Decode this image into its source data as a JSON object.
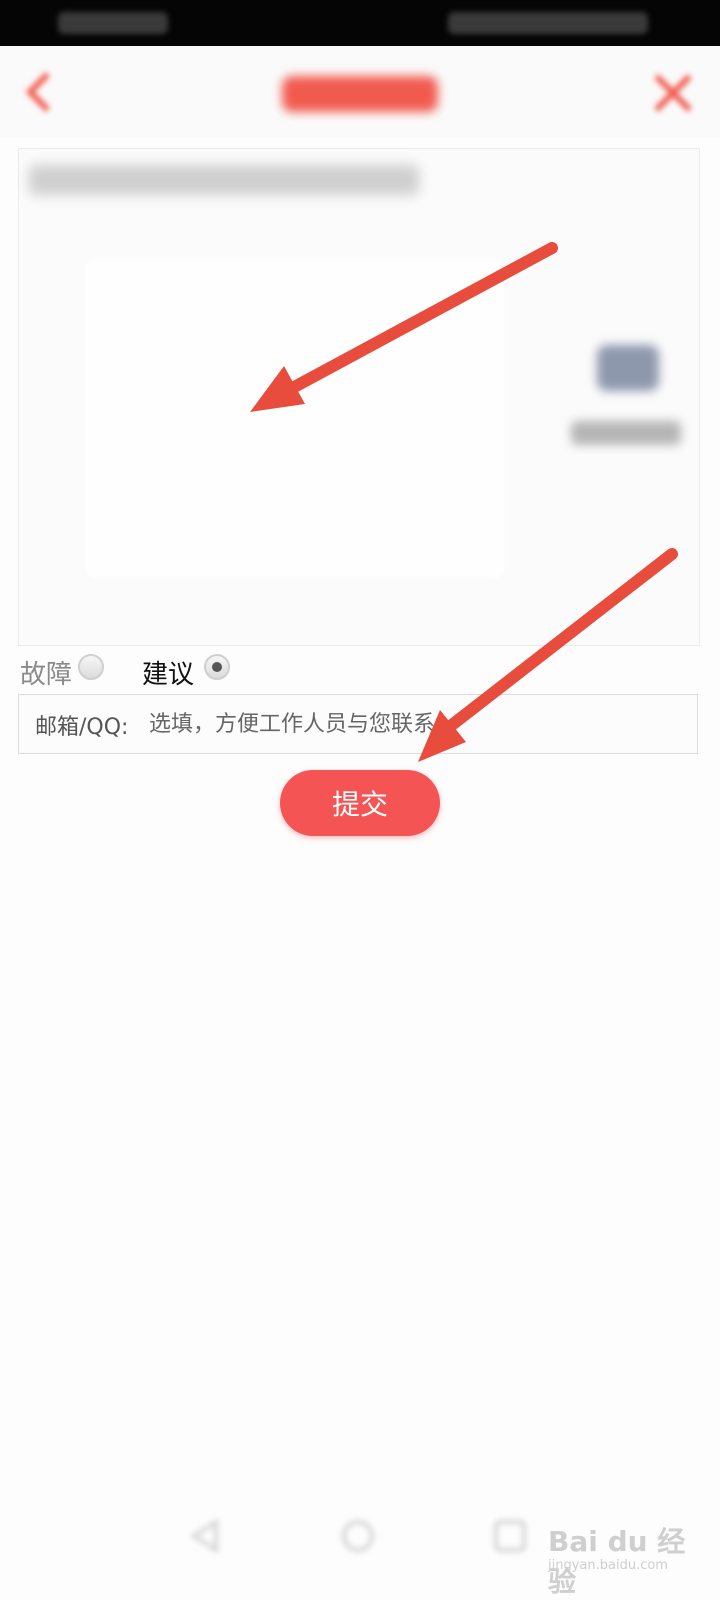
{
  "form": {
    "type_options": [
      {
        "label": "故障",
        "checked": false
      },
      {
        "label": "建议",
        "checked": true
      }
    ],
    "contact_prefix": "邮箱/QQ:",
    "contact_placeholder": "选填，方便工作人员与您联系",
    "submit_label": "提交"
  },
  "annotation_color": "#e84c3d",
  "brand_color": "#f45454",
  "watermark": {
    "main": "Bai du 经验",
    "sub": "jingyan.baidu.com"
  }
}
